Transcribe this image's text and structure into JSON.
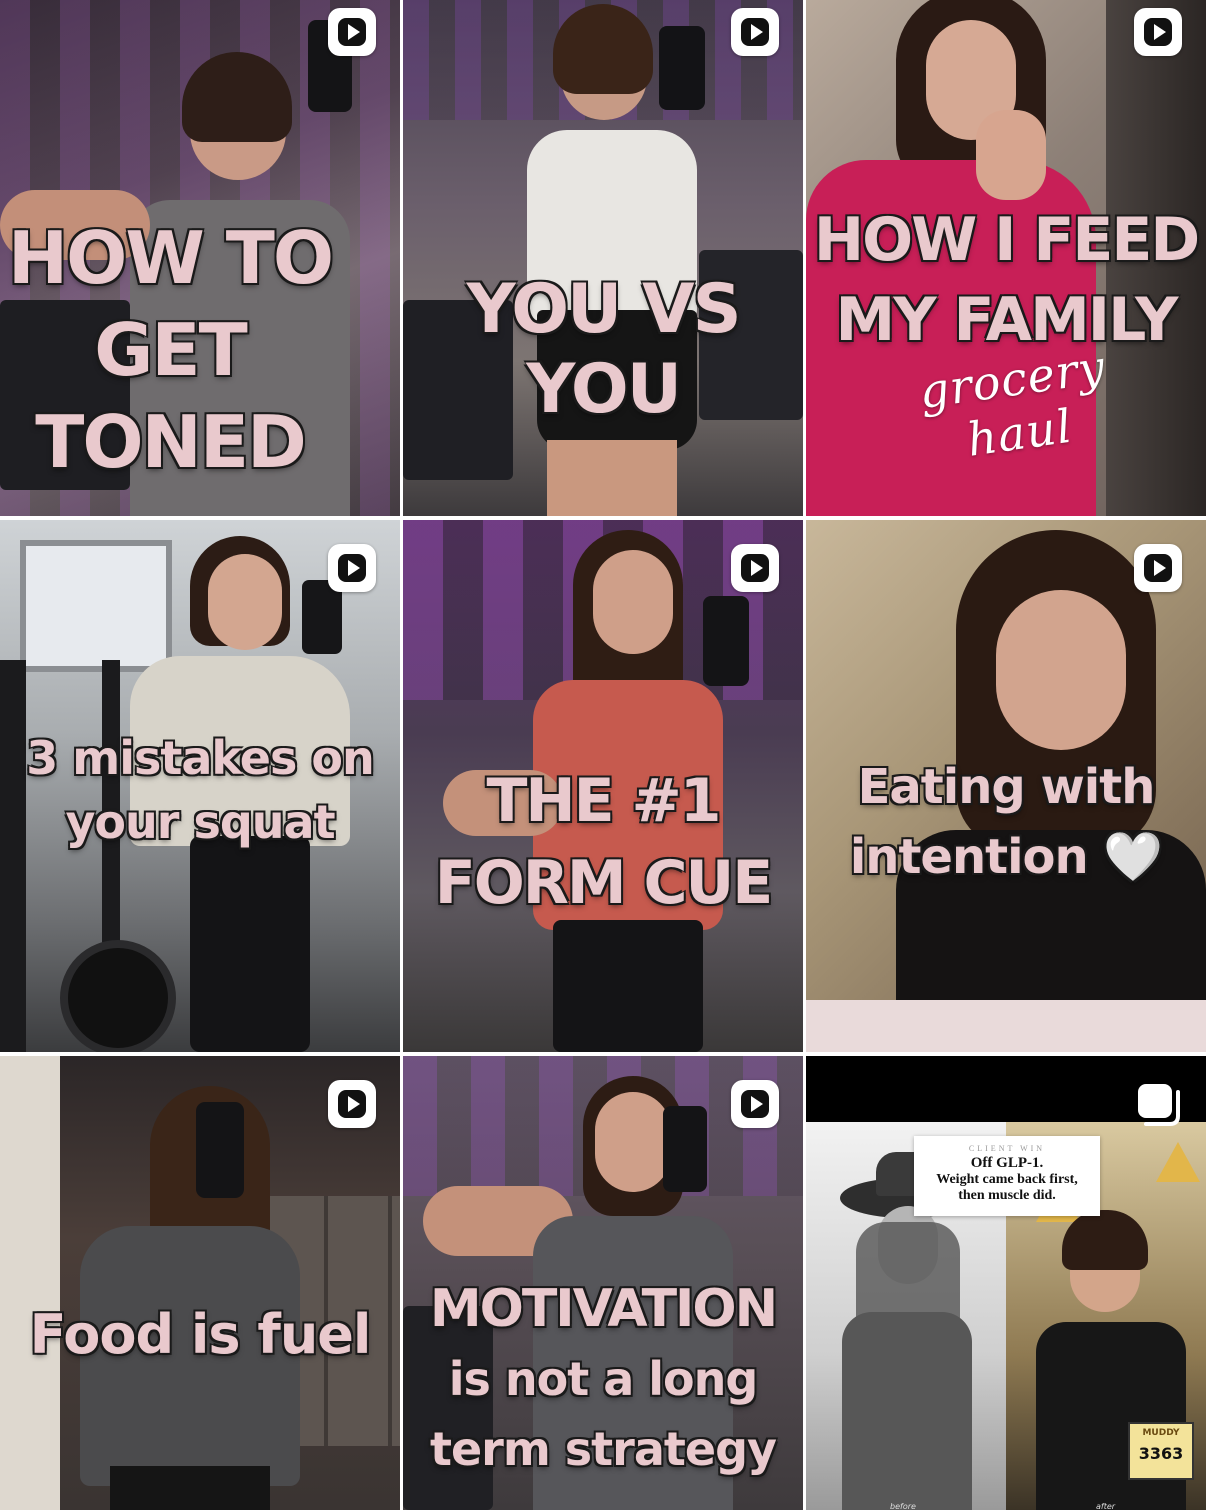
{
  "colors": {
    "overlay_text": "#e9c9cd",
    "overlay_outline": "#1a1a1a",
    "gym_purple": "#5b3566",
    "pink_shirt": "#c81f57"
  },
  "icons": {
    "reel": "play-icon",
    "carousel": "carousel-icon"
  },
  "posts": [
    {
      "type": "reel",
      "lines": [
        "HOW TO",
        "GET",
        "TONED"
      ]
    },
    {
      "type": "reel",
      "lines": [
        "YOU VS YOU"
      ]
    },
    {
      "type": "reel",
      "lines": [
        "HOW I FEED",
        "MY FAMILY"
      ],
      "script": "grocery haul"
    },
    {
      "type": "reel",
      "lines": [
        "3 mistakes on",
        "your squat"
      ]
    },
    {
      "type": "reel",
      "lines": [
        "THE #1",
        "FORM CUE"
      ]
    },
    {
      "type": "reel",
      "lines": [
        "Eating with",
        "intention 🤍"
      ]
    },
    {
      "type": "reel",
      "lines": [
        "Food is fuel"
      ]
    },
    {
      "type": "reel",
      "lines": [
        "MOTIVATION",
        "is not a long",
        "term strategy"
      ]
    },
    {
      "type": "carousel",
      "card": {
        "eyebrow": "CLIENT WIN",
        "lines": [
          "Off GLP-1.",
          "Weight came back first,",
          "then muscle did."
        ]
      },
      "bib_number": "3363",
      "race_logo": "MUDDY",
      "labels": [
        "before",
        "after"
      ]
    }
  ]
}
